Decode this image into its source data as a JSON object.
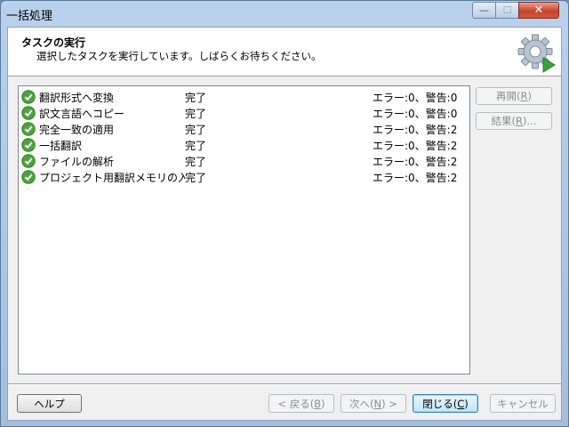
{
  "window": {
    "title": "一括処理",
    "min_glyph": "—",
    "max_glyph": "☐",
    "close_glyph": "✕"
  },
  "header": {
    "title": "タスクの実行",
    "subtitle": "選択したタスクを実行しています。しばらくお待ちください。",
    "icon": "gear-play-icon"
  },
  "tasks": [
    {
      "name": "翻訳形式へ変換",
      "status": "完了",
      "result": "エラー:0、警告:0"
    },
    {
      "name": "訳文言語へコピー",
      "status": "完了",
      "result": "エラー:0、警告:0"
    },
    {
      "name": "完全一致の適用",
      "status": "完了",
      "result": "エラー:0、警告:2"
    },
    {
      "name": "一括翻訳",
      "status": "完了",
      "result": "エラー:0、警告:2"
    },
    {
      "name": "ファイルの解析",
      "status": "完了",
      "result": "エラー:0、警告:2"
    },
    {
      "name": "プロジェクト用翻訳メモリの入力",
      "status": "完了",
      "result": "エラー:0、警告:2"
    }
  ],
  "side_buttons": {
    "restart": {
      "pre": "再開(",
      "key": "R",
      "post": ")"
    },
    "results": {
      "pre": "結果(",
      "key": "R",
      "post": ")..."
    }
  },
  "footer": {
    "help": "ヘルプ",
    "back": {
      "pre": "< 戻る(",
      "key": "B",
      "post": ")"
    },
    "next": {
      "pre": "次へ(",
      "key": "N",
      "post": ") >"
    },
    "close": {
      "pre": "閉じる(",
      "key": "C",
      "post": ")"
    },
    "cancel": "キャンセル"
  },
  "colors": {
    "check_green": "#4aa53a",
    "window_frame": "#b9d1ea",
    "close_red": "#c7432a"
  }
}
